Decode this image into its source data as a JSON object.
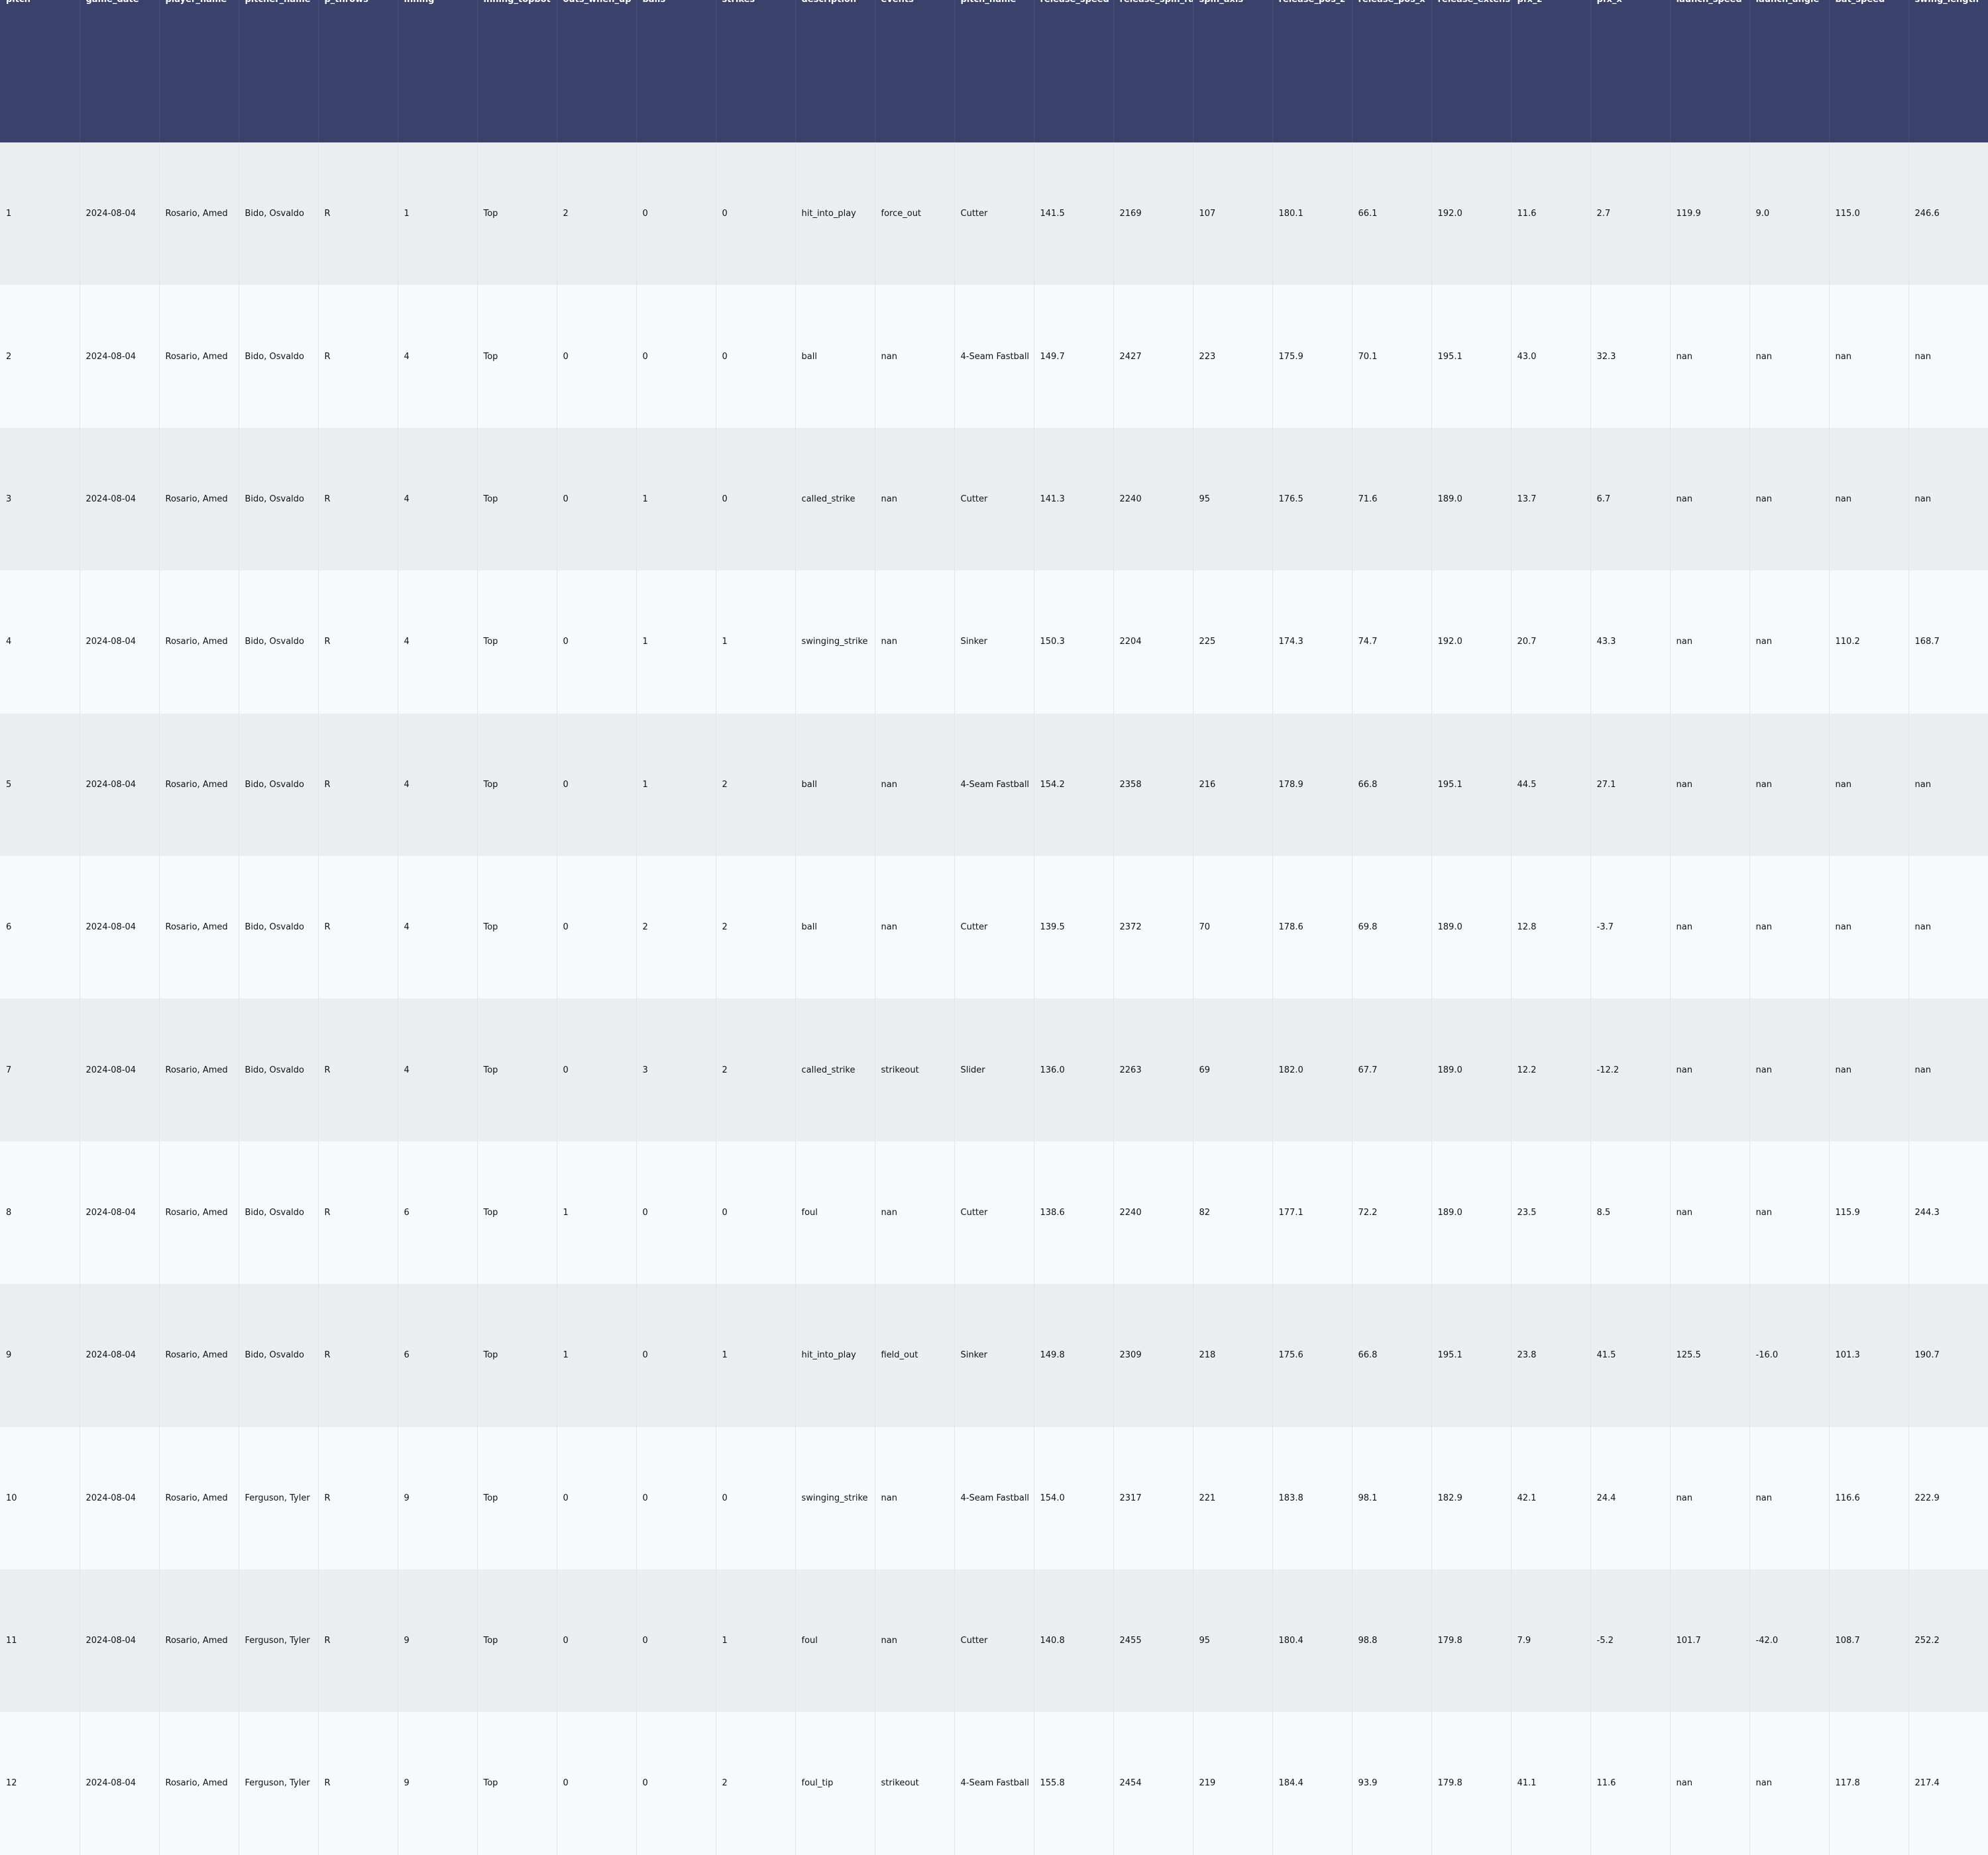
{
  "table": {
    "columns": [
      "pitch",
      "game_date",
      "player_name",
      "pitcher_name",
      "p_throws",
      "inning",
      "inning_topbot",
      "outs_when_up",
      "balls",
      "strikes",
      "description",
      "events",
      "pitch_name",
      "release_speed",
      "release_spin_rate",
      "spin_axis",
      "release_pos_z",
      "release_pos_x",
      "release_extension",
      "pfx_z",
      "pfx_x",
      "launch_speed",
      "launch_angle",
      "bat_speed",
      "swing_length"
    ],
    "rows": [
      [
        "1",
        "2024-08-04",
        "Rosario, Amed",
        "Bido, Osvaldo",
        "R",
        "1",
        "Top",
        "2",
        "0",
        "0",
        "hit_into_play",
        "force_out",
        "Cutter",
        "141.5",
        "2169",
        "107",
        "180.1",
        "66.1",
        "192.0",
        "11.6",
        "2.7",
        "119.9",
        "9.0",
        "115.0",
        "246.6"
      ],
      [
        "2",
        "2024-08-04",
        "Rosario, Amed",
        "Bido, Osvaldo",
        "R",
        "4",
        "Top",
        "0",
        "0",
        "0",
        "ball",
        "nan",
        "4-Seam Fastball",
        "149.7",
        "2427",
        "223",
        "175.9",
        "70.1",
        "195.1",
        "43.0",
        "32.3",
        "nan",
        "nan",
        "nan",
        "nan"
      ],
      [
        "3",
        "2024-08-04",
        "Rosario, Amed",
        "Bido, Osvaldo",
        "R",
        "4",
        "Top",
        "0",
        "1",
        "0",
        "called_strike",
        "nan",
        "Cutter",
        "141.3",
        "2240",
        "95",
        "176.5",
        "71.6",
        "189.0",
        "13.7",
        "6.7",
        "nan",
        "nan",
        "nan",
        "nan"
      ],
      [
        "4",
        "2024-08-04",
        "Rosario, Amed",
        "Bido, Osvaldo",
        "R",
        "4",
        "Top",
        "0",
        "1",
        "1",
        "swinging_strike",
        "nan",
        "Sinker",
        "150.3",
        "2204",
        "225",
        "174.3",
        "74.7",
        "192.0",
        "20.7",
        "43.3",
        "nan",
        "nan",
        "110.2",
        "168.7"
      ],
      [
        "5",
        "2024-08-04",
        "Rosario, Amed",
        "Bido, Osvaldo",
        "R",
        "4",
        "Top",
        "0",
        "1",
        "2",
        "ball",
        "nan",
        "4-Seam Fastball",
        "154.2",
        "2358",
        "216",
        "178.9",
        "66.8",
        "195.1",
        "44.5",
        "27.1",
        "nan",
        "nan",
        "nan",
        "nan"
      ],
      [
        "6",
        "2024-08-04",
        "Rosario, Amed",
        "Bido, Osvaldo",
        "R",
        "4",
        "Top",
        "0",
        "2",
        "2",
        "ball",
        "nan",
        "Cutter",
        "139.5",
        "2372",
        "70",
        "178.6",
        "69.8",
        "189.0",
        "12.8",
        "-3.7",
        "nan",
        "nan",
        "nan",
        "nan"
      ],
      [
        "7",
        "2024-08-04",
        "Rosario, Amed",
        "Bido, Osvaldo",
        "R",
        "4",
        "Top",
        "0",
        "3",
        "2",
        "called_strike",
        "strikeout",
        "Slider",
        "136.0",
        "2263",
        "69",
        "182.0",
        "67.7",
        "189.0",
        "12.2",
        "-12.2",
        "nan",
        "nan",
        "nan",
        "nan"
      ],
      [
        "8",
        "2024-08-04",
        "Rosario, Amed",
        "Bido, Osvaldo",
        "R",
        "6",
        "Top",
        "1",
        "0",
        "0",
        "foul",
        "nan",
        "Cutter",
        "138.6",
        "2240",
        "82",
        "177.1",
        "72.2",
        "189.0",
        "23.5",
        "8.5",
        "nan",
        "nan",
        "115.9",
        "244.3"
      ],
      [
        "9",
        "2024-08-04",
        "Rosario, Amed",
        "Bido, Osvaldo",
        "R",
        "6",
        "Top",
        "1",
        "0",
        "1",
        "hit_into_play",
        "field_out",
        "Sinker",
        "149.8",
        "2309",
        "218",
        "175.6",
        "66.8",
        "195.1",
        "23.8",
        "41.5",
        "125.5",
        "-16.0",
        "101.3",
        "190.7"
      ],
      [
        "10",
        "2024-08-04",
        "Rosario, Amed",
        "Ferguson, Tyler",
        "R",
        "9",
        "Top",
        "0",
        "0",
        "0",
        "swinging_strike",
        "nan",
        "4-Seam Fastball",
        "154.0",
        "2317",
        "221",
        "183.8",
        "98.1",
        "182.9",
        "42.1",
        "24.4",
        "nan",
        "nan",
        "116.6",
        "222.9"
      ],
      [
        "11",
        "2024-08-04",
        "Rosario, Amed",
        "Ferguson, Tyler",
        "R",
        "9",
        "Top",
        "0",
        "0",
        "1",
        "foul",
        "nan",
        "Cutter",
        "140.8",
        "2455",
        "95",
        "180.4",
        "98.8",
        "179.8",
        "7.9",
        "-5.2",
        "101.7",
        "-42.0",
        "108.7",
        "252.2"
      ],
      [
        "12",
        "2024-08-04",
        "Rosario, Amed",
        "Ferguson, Tyler",
        "R",
        "9",
        "Top",
        "0",
        "0",
        "2",
        "foul_tip",
        "strikeout",
        "4-Seam Fastball",
        "155.8",
        "2454",
        "219",
        "184.4",
        "93.9",
        "179.8",
        "41.1",
        "11.6",
        "nan",
        "nan",
        "117.8",
        "217.4"
      ]
    ]
  },
  "colors": {
    "header_bg": "#3a426b",
    "header_text": "#ffffff",
    "row_odd": "#ecedf1",
    "row_even": "#f8f9fc"
  }
}
